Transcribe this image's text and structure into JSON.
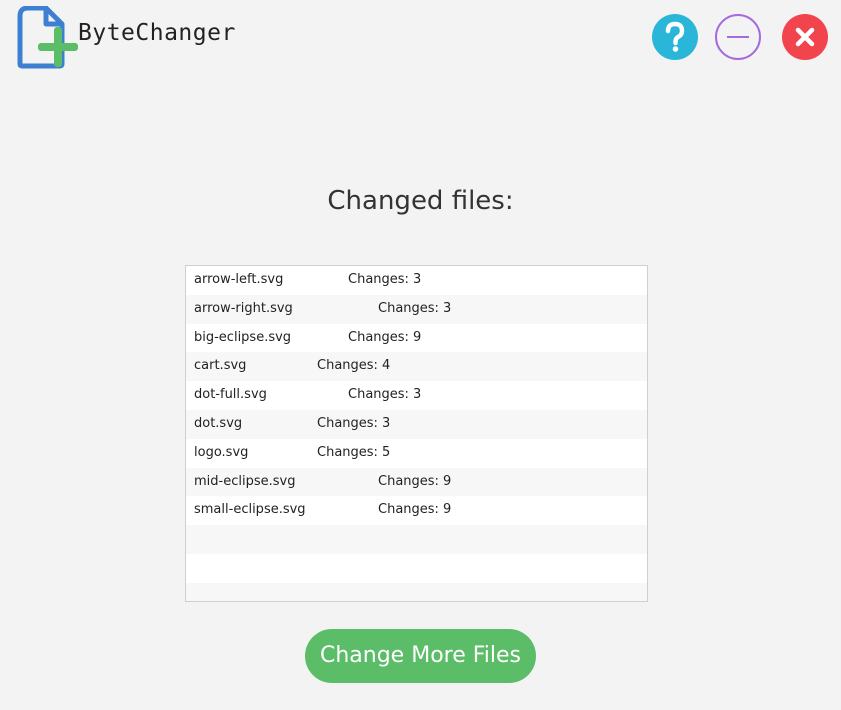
{
  "app": {
    "title": "ByteChanger"
  },
  "window_controls": {
    "help_icon": "question-icon",
    "minimize_icon": "minus-icon",
    "close_icon": "close-x-icon",
    "colors": {
      "help": "#29b6d9",
      "minimize": "#a46be0",
      "close": "#f2444c"
    }
  },
  "main": {
    "heading": "Changed files:",
    "files": [
      {
        "name": "arrow-left.svg",
        "changes": "Changes: 3"
      },
      {
        "name": "arrow-right.svg",
        "changes": "Changes: 3"
      },
      {
        "name": "big-eclipse.svg",
        "changes": "Changes: 9"
      },
      {
        "name": "cart.svg",
        "changes": "Changes: 4"
      },
      {
        "name": "dot-full.svg",
        "changes": "Changes: 3"
      },
      {
        "name": "dot.svg",
        "changes": "Changes: 3"
      },
      {
        "name": "logo.svg",
        "changes": "Changes: 5"
      },
      {
        "name": "mid-eclipse.svg",
        "changes": "Changes: 9"
      },
      {
        "name": "small-eclipse.svg",
        "changes": "Changes: 9"
      },
      {
        "name": "",
        "changes": ""
      },
      {
        "name": "",
        "changes": ""
      },
      {
        "name": "",
        "changes": ""
      }
    ],
    "button_label": "Change More Files",
    "accent_color": "#5cbd68"
  }
}
